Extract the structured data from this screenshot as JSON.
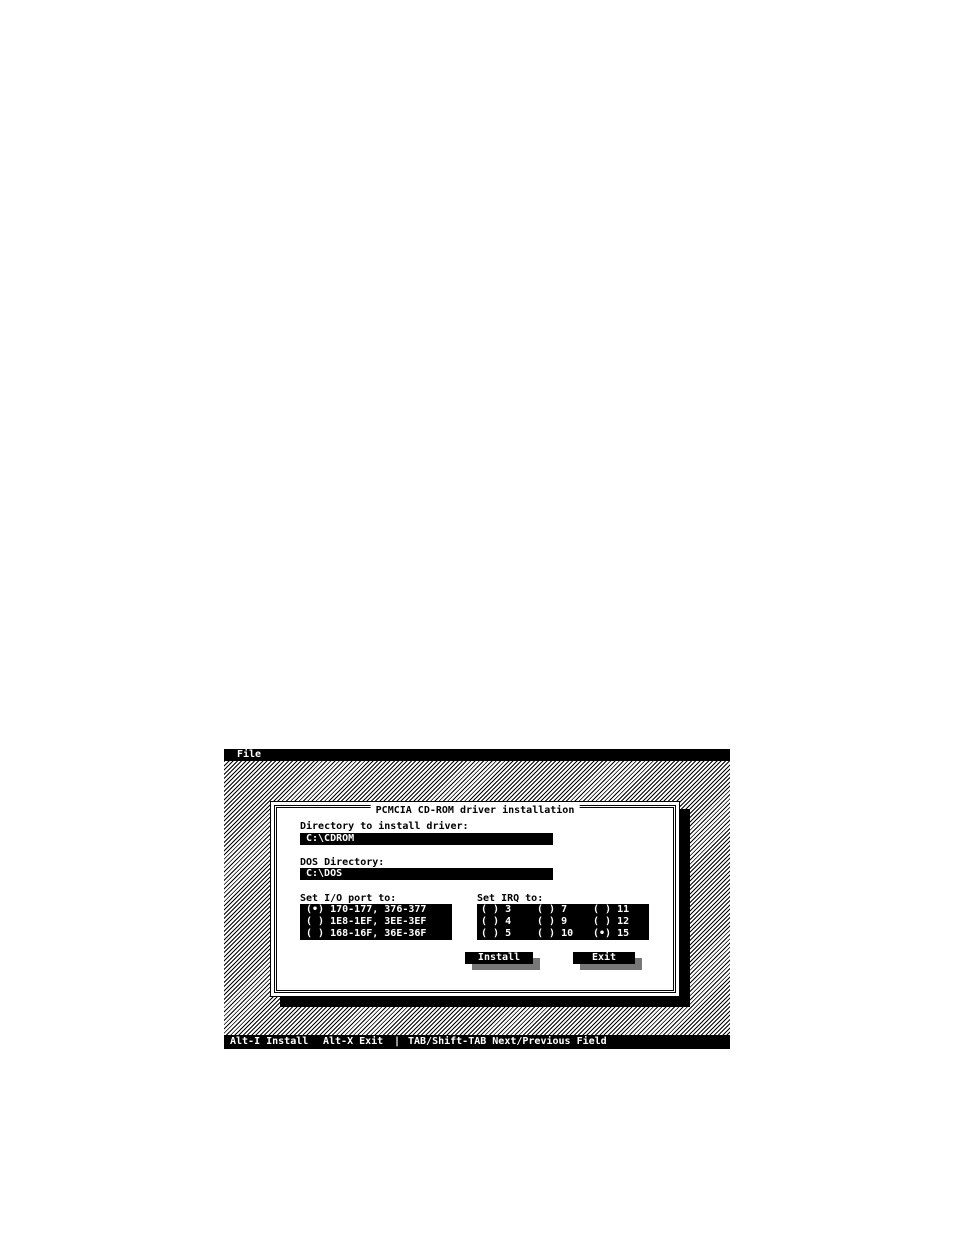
{
  "menubar": {
    "file": "File"
  },
  "statusbar": {
    "install_hint": "Alt-I Install",
    "exit_hint": "Alt-X Exit",
    "separator": "|",
    "tab_hint": "TAB/Shift-TAB Next/Previous Field"
  },
  "dialog": {
    "title": "PCMCIA CD-ROM driver installation",
    "install_dir": {
      "label": "Directory to install driver:",
      "value": "C:\\CDROM"
    },
    "dos_dir": {
      "label": "DOS Directory:",
      "value": "C:\\DOS"
    },
    "io_port": {
      "label": "Set I/O port to:",
      "options": [
        {
          "mark": "(•)",
          "text": "170-177, 376-377"
        },
        {
          "mark": "( )",
          "text": "1E8-1EF, 3EE-3EF"
        },
        {
          "mark": "( )",
          "text": "168-16F, 36E-36F"
        }
      ]
    },
    "irq": {
      "label": "Set IRQ to:",
      "options": [
        {
          "mark": "( )",
          "text": "3"
        },
        {
          "mark": "( )",
          "text": "7"
        },
        {
          "mark": "( )",
          "text": "11"
        },
        {
          "mark": "( )",
          "text": "4"
        },
        {
          "mark": "( )",
          "text": "9"
        },
        {
          "mark": "( )",
          "text": "12"
        },
        {
          "mark": "( )",
          "text": "5"
        },
        {
          "mark": "( )",
          "text": "10"
        },
        {
          "mark": "(•)",
          "text": "15"
        }
      ]
    },
    "buttons": {
      "install": "Install",
      "exit": "Exit"
    }
  }
}
